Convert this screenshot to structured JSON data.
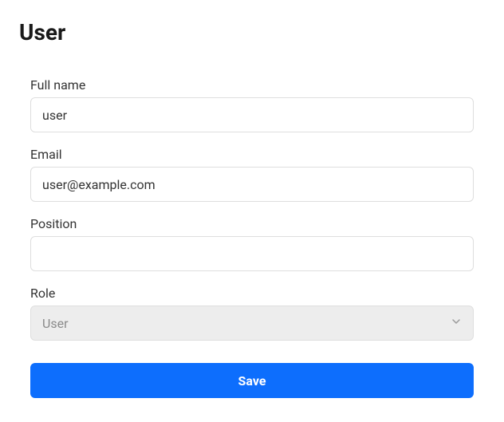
{
  "title": "User",
  "fields": {
    "fullname": {
      "label": "Full name",
      "value": "user",
      "placeholder": ""
    },
    "email": {
      "label": "Email",
      "value": "user@example.com",
      "placeholder": ""
    },
    "position": {
      "label": "Position",
      "value": "",
      "placeholder": ""
    },
    "role": {
      "label": "Role",
      "selected": "User"
    }
  },
  "actions": {
    "save_label": "Save"
  },
  "colors": {
    "primary": "#0d6efd",
    "disabled_bg": "#ededed",
    "border": "#dedede",
    "text": "#333333",
    "muted": "#8a8a8a"
  }
}
